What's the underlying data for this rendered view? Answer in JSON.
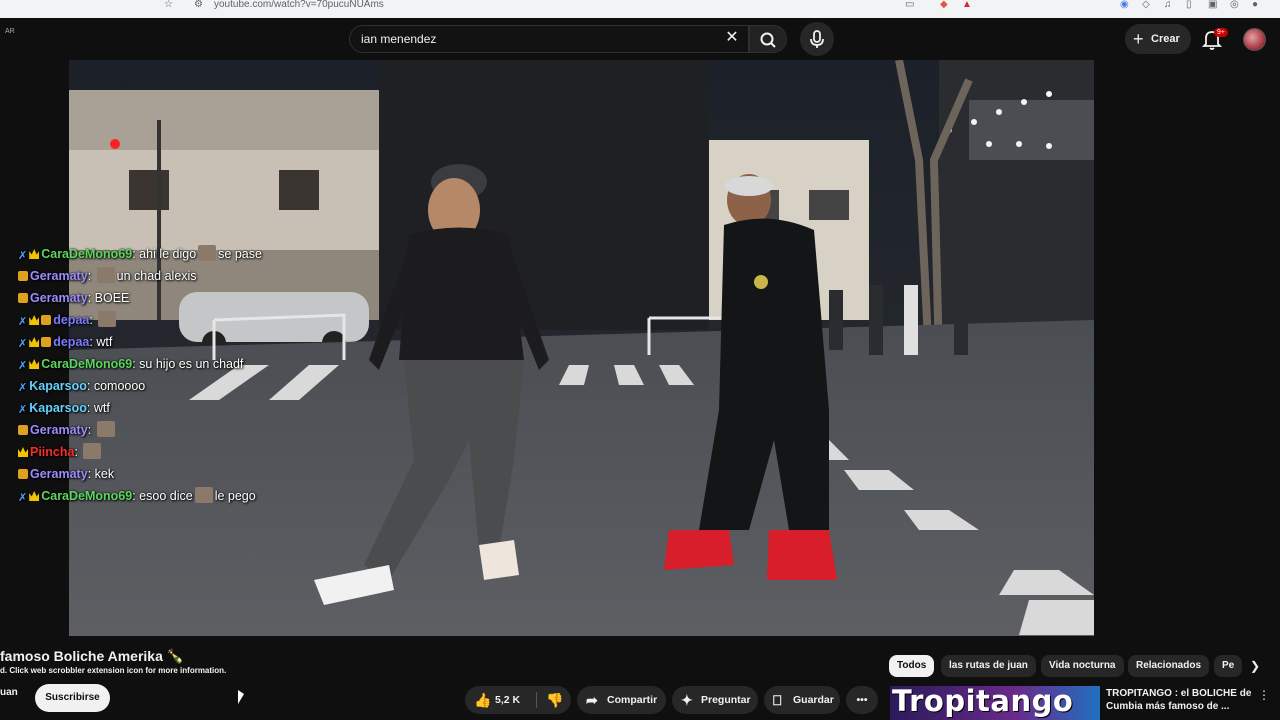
{
  "browser": {
    "url": "youtube.com/watch?v=70pucuNUAms"
  },
  "header": {
    "region": "AR",
    "search_value": "ian menendez",
    "create_label": "Crear",
    "notifications": "9+"
  },
  "chat": [
    {
      "badges": [
        "sword",
        "crown"
      ],
      "user": "CaraDeMono69",
      "color": "#5cd65c",
      "text": "ahi le digo",
      "emote_after": true,
      "text2": "se pase"
    },
    {
      "badges": [
        "box"
      ],
      "user": "Geramaty",
      "color": "#9b8cff",
      "text": "un chad alexis",
      "emote_before": true
    },
    {
      "badges": [
        "box"
      ],
      "user": "Geramaty",
      "color": "#9b8cff",
      "text": "BOEE"
    },
    {
      "badges": [
        "sword",
        "crown",
        "box"
      ],
      "user": "depaa",
      "color": "#7a7aff",
      "text": "",
      "emote_before": true
    },
    {
      "badges": [
        "sword",
        "crown",
        "box"
      ],
      "user": "depaa",
      "color": "#7a7aff",
      "text": "wtf"
    },
    {
      "badges": [
        "sword",
        "crown"
      ],
      "user": "CaraDeMono69",
      "color": "#5cd65c",
      "text": "su hijo es un chadf"
    },
    {
      "badges": [
        "sword"
      ],
      "user": "Kaparsoo",
      "color": "#63d2ff",
      "text": "comoooo"
    },
    {
      "badges": [
        "sword"
      ],
      "user": "Kaparsoo",
      "color": "#63d2ff",
      "text": "wtf"
    },
    {
      "badges": [
        "box"
      ],
      "user": "Geramaty",
      "color": "#9b8cff",
      "text": "",
      "emote_before": true
    },
    {
      "badges": [
        "crown"
      ],
      "user": "Piincha",
      "color": "#ff2a2a",
      "text": "",
      "emote_before": true
    },
    {
      "badges": [
        "box"
      ],
      "user": "Geramaty",
      "color": "#9b8cff",
      "text": "kek"
    },
    {
      "badges": [
        "sword",
        "crown"
      ],
      "user": "CaraDeMono69",
      "color": "#5cd65c",
      "text": "esoo dice",
      "emote_after": true,
      "text2": "le pego"
    }
  ],
  "video": {
    "title": "famoso Boliche Amerika 🍾",
    "scrobbler_note": "d. Click web scrobbler extension icon for more information.",
    "channel": "uan",
    "subscribe_label": "Suscribirse",
    "likes": "5,2 K",
    "share_label": "Compartir",
    "ask_label": "Preguntar",
    "save_label": "Guardar"
  },
  "chips": [
    "Todos",
    "las rutas de juan",
    "Vida nocturna",
    "Relacionados",
    "Pe"
  ],
  "recommendation": {
    "thumb_text": "Tropitango",
    "title": "TROPITANGO : el BOLICHE de Cumbia  más famoso de ..."
  },
  "colors": {
    "background": "#0f0f0f",
    "chip_bg": "#272727",
    "accent_red": "#cc0000"
  }
}
